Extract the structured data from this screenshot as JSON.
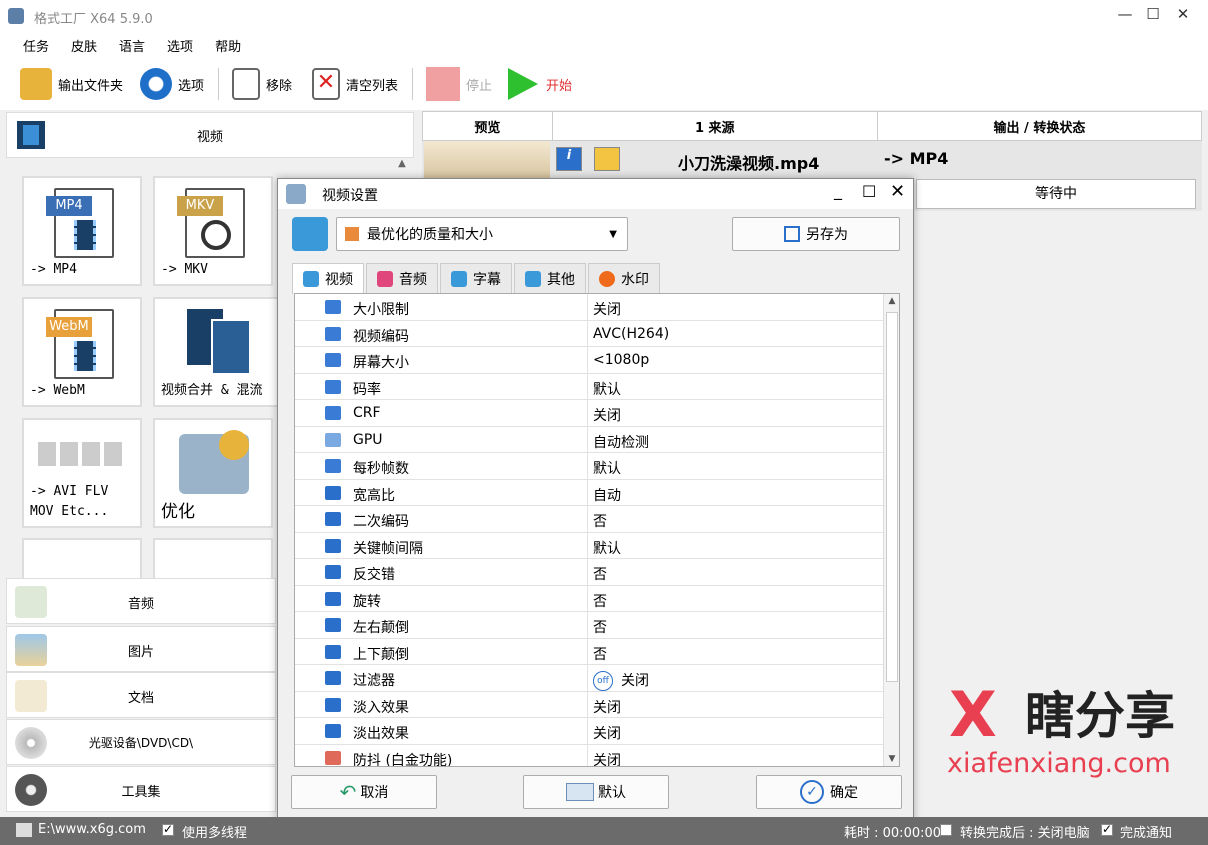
{
  "app": {
    "title": "格式工厂 X64 5.9.0"
  },
  "menu": [
    "任务",
    "皮肤",
    "语言",
    "选项",
    "帮助"
  ],
  "toolbar": {
    "output_folder": "输出文件夹",
    "options": "选项",
    "remove": "移除",
    "clear_list": "清空列表",
    "stop": "停止",
    "start": "开始"
  },
  "left": {
    "video_header": "视频",
    "tiles": [
      {
        "badge": "MP4",
        "caption": "-> MP4"
      },
      {
        "badge": "MKV",
        "caption": "-> MKV"
      },
      {
        "badge": "WebM",
        "caption": "-> WebM"
      },
      {
        "caption": "视频合并 & 混流"
      },
      {
        "caption": "-> AVI FLV\nMOV Etc..."
      },
      {
        "caption": "优化"
      }
    ],
    "categories": [
      "音频",
      "图片",
      "文档",
      "光驱设备\\DVD\\CD\\",
      "工具集"
    ]
  },
  "list": {
    "headers": [
      "预览",
      "1 来源",
      "输出 / 转换状态"
    ],
    "rows": [
      {
        "source": "小刀洗澡视频.mp4",
        "output": "-> MP4",
        "status": "等待中"
      }
    ]
  },
  "dialog": {
    "title": "视频设置",
    "preset": "最优化的质量和大小",
    "save_as": "另存为",
    "tabs": [
      "视频",
      "音频",
      "字幕",
      "其他",
      "水印"
    ],
    "settings": [
      {
        "key": "大小限制",
        "value": "关闭",
        "icon_color": "#3a7bd5"
      },
      {
        "key": "视频编码",
        "value": "AVC(H264)",
        "icon_color": "#3a7bd5"
      },
      {
        "key": "屏幕大小",
        "value": "<1080p",
        "icon_color": "#3a7bd5"
      },
      {
        "key": "码率",
        "value": "默认",
        "icon_color": "#3a7bd5"
      },
      {
        "key": "CRF",
        "value": "关闭",
        "icon_color": "#3a7bd5"
      },
      {
        "key": "GPU",
        "value": "自动检测",
        "icon_color": "#7aa8e0"
      },
      {
        "key": "每秒帧数",
        "value": "默认",
        "icon_color": "#3a7bd5"
      },
      {
        "key": "宽高比",
        "value": "自动",
        "icon_color": "#2a6fc9"
      },
      {
        "key": "二次编码",
        "value": "否",
        "icon_color": "#2a6fc9"
      },
      {
        "key": "关键帧间隔",
        "value": "默认",
        "icon_color": "#2a6fc9"
      },
      {
        "key": "反交错",
        "value": "否",
        "icon_color": "#2a6fc9"
      },
      {
        "key": "旋转",
        "value": "否",
        "icon_color": "#2a6fc9"
      },
      {
        "key": "左右颠倒",
        "value": "否",
        "icon_color": "#2a6fc9"
      },
      {
        "key": "上下颠倒",
        "value": "否",
        "icon_color": "#2a6fc9"
      },
      {
        "key": "过滤器",
        "value": "关闭",
        "icon_color": "#2a6fc9",
        "value_icon": "off"
      },
      {
        "key": "淡入效果",
        "value": "关闭",
        "icon_color": "#2a6fc9"
      },
      {
        "key": "淡出效果",
        "value": "关闭",
        "icon_color": "#2a6fc9"
      },
      {
        "key": "防抖 (白金功能)",
        "value": "关闭",
        "icon_color": "#e06a5a"
      }
    ],
    "buttons": {
      "cancel": "取消",
      "default": "默认",
      "ok": "确定"
    }
  },
  "status": {
    "path": "E:\\www.x6g.com",
    "multithread": "使用多线程",
    "elapsed": "耗时 : 00:00:00",
    "shutdown": "转换完成后 : 关闭电脑",
    "notify": "完成通知"
  },
  "watermark": {
    "logo": "X",
    "name": "瞎分享",
    "url": "xiafenxiang.com"
  },
  "colors": {
    "accent": "#1f6fc9",
    "start_green": "#2ec02e",
    "stop_red": "#f0a0a0",
    "watermark_red": "#e83f51"
  }
}
